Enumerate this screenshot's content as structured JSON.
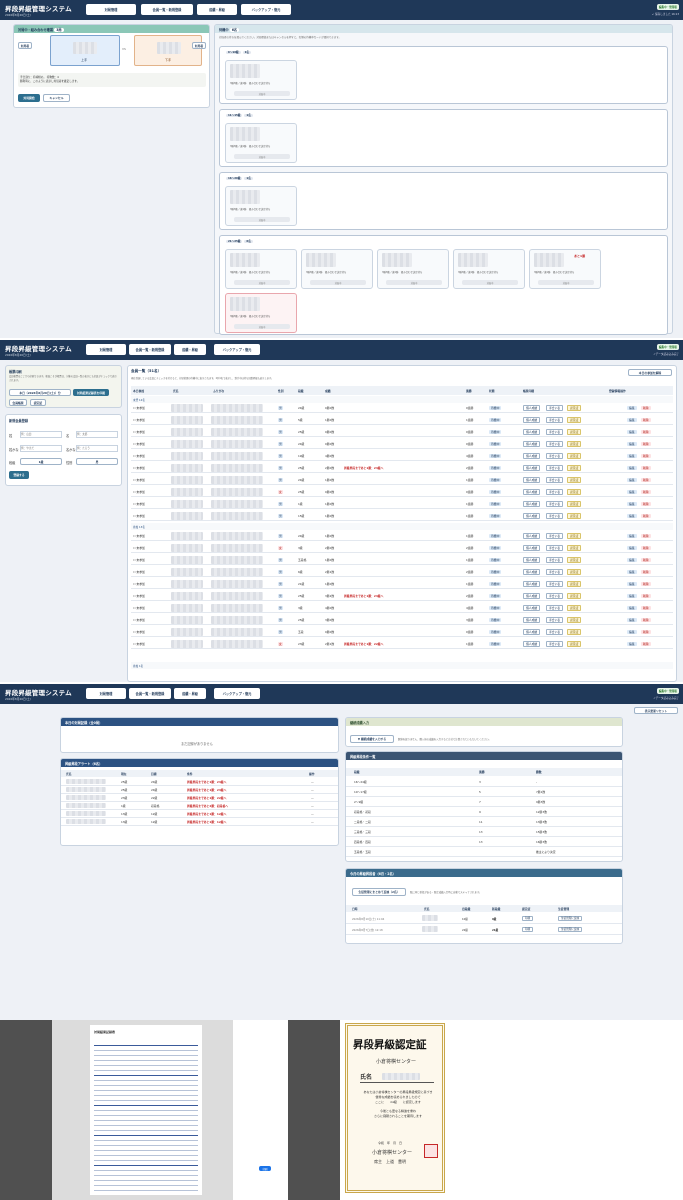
{
  "app": {
    "title": "昇段昇級管理システム",
    "date": "2026年8月26日(土)",
    "tabs": [
      "対局管理",
      "会員一覧・新規登録",
      "成績・昇級",
      "バックアップ・復元"
    ],
    "user_badge": "編集中・管理者",
    "logout": "ログアウト",
    "logout2": "↙ 保存しました 16:13",
    "logout3": "ノデータ読み込み完了"
  },
  "panel1": {
    "battle_header": "対局中・組み合わせ確認",
    "battle_badge": "3局",
    "player_a_label": "上手",
    "player_b_label": "下手",
    "vs": "VS",
    "btn_confirm": "対局確定",
    "btn_side": "対局者",
    "note1": "手合割り：",
    "note1b": "持将棋の。 持駒数：4",
    "note2": "勝利時に、このように表示し対局者を確定します。",
    "start_btn": "対局開始",
    "cancel_btn": "キャンセル",
    "wait_header": "待機中",
    "wait_badge": "6名",
    "wait_hint": "対局者の待ちを選んでください。対局開始またはキャンセルを押すと、右側の待機中カードが選択できます。",
    "groups": [
      {
        "title": "6〜10級",
        "count": "1名",
        "cards": 1
      },
      {
        "title": "11〜15級",
        "count": "1名",
        "cards": 1
      },
      {
        "title": "16〜20級",
        "count": "1名",
        "cards": 1
      },
      {
        "title": "21〜25級",
        "count": "6名",
        "cards": 6
      }
    ],
    "card_text": "3勝3敗 / 連1勝　組み合わせ決定待ち",
    "card_btn": "対局中",
    "card_alert": "あと1勝"
  },
  "panel2": {
    "list_title": "会員一覧（51名）",
    "list_hint": "現在登録している会員にチェックを付けると、対局管理の待機中に表示されます。2列1名で表示し、割引中は持ち回数昇級も表示します。",
    "today_btn": "本日の参加を解除",
    "side1_title": "帳票印刷",
    "side1_text": "会員帳票はここから印刷できます。帳面こそが帳票は、対象の会員一覧の表示にも全員がチェックで表示されます。",
    "date_select": "本日（2026年8月26日(土)）分",
    "print_btn": "対局結果記録表を印刷",
    "members_btn": "会員帳票",
    "cert_btn": "認定証",
    "side2_title": "新規会員登録",
    "f_last": "姓",
    "f_last_ph": "例：山田",
    "f_first": "名",
    "f_first_ph": "例：太郎",
    "f_lastk": "姓かな",
    "f_lastk_ph": "例：やまだ",
    "f_firstk": "名かな",
    "f_firstk_ph": "例：たろう",
    "f_rank": "段級",
    "f_rank_val": "1級",
    "f_sex": "性別",
    "f_sex_val": "男",
    "register_btn": "登録する",
    "cols": [
      "本日参加",
      "氏名",
      "ふりがな",
      "性別",
      "段級",
      "成績",
      "連勝",
      "状態",
      "帳票印刷",
      "登録情報操作"
    ],
    "group1": "未登",
    "group1_count": "12名",
    "group2": "参加",
    "group2_count": "13名",
    "group3": "参加",
    "group3_count": "1名",
    "rows1": [
      {
        "sex": "男",
        "rank": "24級",
        "rec": "0勝0敗",
        "streak": "0連勝",
        "msg": ""
      },
      {
        "sex": "男",
        "rank": "5級",
        "rec": "1勝0敗",
        "streak": "1連勝",
        "msg": ""
      },
      {
        "sex": "男",
        "rank": "25級",
        "rec": "0勝0敗",
        "streak": "0連勝",
        "msg": ""
      },
      {
        "sex": "男",
        "rank": "24級",
        "rec": "0勝0敗",
        "streak": "0連勝",
        "msg": ""
      },
      {
        "sex": "男",
        "rank": "19級",
        "rec": "4勝0敗",
        "streak": "4連勝",
        "msg": ""
      },
      {
        "sex": "男",
        "rank": "25級",
        "rec": "2勝0敗",
        "streak": "2連勝",
        "msg": "昇級昇段まであと1勝：24級へ"
      },
      {
        "sex": "男",
        "rank": "24級",
        "rec": "1勝0敗",
        "streak": "1連勝",
        "msg": ""
      },
      {
        "sex": "女",
        "rank": "25級",
        "rec": "0勝0敗",
        "streak": "0連勝",
        "msg": ""
      },
      {
        "sex": "男",
        "rank": "1級",
        "rec": "1勝0敗",
        "streak": "1連勝",
        "msg": ""
      },
      {
        "sex": "男",
        "rank": "15級",
        "rec": "1勝0敗",
        "streak": "1連勝",
        "msg": ""
      }
    ],
    "rows2": [
      {
        "sex": "男",
        "rank": "24級",
        "rec": "1勝0敗",
        "streak": "1連勝",
        "msg": ""
      },
      {
        "sex": "女",
        "rank": "3級",
        "rec": "2勝0敗",
        "streak": "2連勝",
        "msg": ""
      },
      {
        "sex": "男",
        "rank": "五段格",
        "rec": "1勝0敗",
        "streak": "1連勝",
        "msg": ""
      },
      {
        "sex": "男",
        "rank": "6級",
        "rec": "2勝1敗",
        "streak": "2連勝",
        "msg": ""
      },
      {
        "sex": "男",
        "rank": "21級",
        "rec": "1勝0敗",
        "streak": "1連勝",
        "msg": ""
      },
      {
        "sex": "男",
        "rank": "25級",
        "rec": "3勝2敗",
        "streak": "2連勝",
        "msg": "昇級昇段まであと1勝：24級へ"
      },
      {
        "sex": "男",
        "rank": "3級",
        "rec": "4勝0敗",
        "streak": "4連勝",
        "msg": ""
      },
      {
        "sex": "男",
        "rank": "25級",
        "rec": "3勝0敗",
        "streak": "3連勝",
        "msg": ""
      },
      {
        "sex": "男",
        "rank": "五段",
        "rec": "0勝0敗",
        "streak": "0連勝",
        "msg": ""
      },
      {
        "sex": "女",
        "rank": "23級",
        "rec": "2勝1敗",
        "streak": "1連勝",
        "msg": "昇級昇段まであと1勝：22級へ"
      }
    ],
    "row_status": "待機中",
    "b_personal": "個人成績",
    "b_hand": "手合い表",
    "b_cert": "認定証",
    "b_edit": "編集",
    "b_del": "削除",
    "row_join": "未参加"
  },
  "panel3": {
    "reset_btn": "表示更新リセット",
    "today_title": "本日の対局記録（全0局）",
    "today_empty": "まだ記録がありません",
    "alert_title": "昇級昇段アラート（6名）",
    "alert_cols": [
      "氏名",
      "現在",
      "目標",
      "条件",
      "操作"
    ],
    "alerts": [
      {
        "cur": "25級",
        "tgt": "24級",
        "cond": "昇級昇段まであと1勝：24級へ",
        "op": "—"
      },
      {
        "cur": "25級",
        "tgt": "24級",
        "cond": "昇級昇段まであと1勝：24級へ",
        "op": "—"
      },
      {
        "cur": "23級",
        "tgt": "22級",
        "cond": "昇級昇段まであと1勝：22級へ",
        "op": "—"
      },
      {
        "cur": "1級",
        "tgt": "初段格",
        "cond": "昇級昇段まであと2勝：初段格へ",
        "op": "—"
      },
      {
        "cur": "13級",
        "tgt": "12級",
        "cond": "昇級昇段まであと1勝：12級へ",
        "op": "—"
      },
      {
        "cur": "13級",
        "tgt": "12級",
        "cond": "昇級昇段まであと1勝：12級へ",
        "op": "—"
      }
    ],
    "input_title": "継続成績入力",
    "input_btn": "▼ 継続成績を入力する",
    "input_hint": "数値を誤りません、購入前の成績を入力すると方式で計算されていただいてください。",
    "cond_title": "昇級昇段条件一覧",
    "cond_cols": [
      "段級",
      "連勝",
      "勝数"
    ],
    "conds": [
      {
        "r": "16〜24級",
        "s": "3",
        "w": "-"
      },
      {
        "r": "10〜17級",
        "s": "5",
        "w": "7勝1敗"
      },
      {
        "r": "2〜9級",
        "s": "7",
        "w": "9勝3敗"
      },
      {
        "r": "初段格・初段",
        "s": "9",
        "w": "12勝3敗"
      },
      {
        "r": "二段格・二段",
        "s": "11",
        "w": "13勝3敗"
      },
      {
        "r": "三段格・三段",
        "s": "13",
        "w": "15勝3敗"
      },
      {
        "r": "四段格・四段",
        "s": "13",
        "w": "16勝3敗"
      },
      {
        "r": "五段格・五段",
        "s": "",
        "w": "推主により決定"
      }
    ],
    "month_title": "今月の昇級昇段者（6月・2名）",
    "month_btn": "生徒管理にまとめて反映（2名）",
    "month_hint": "既に同じ新段がある・既定成績入力時に自動でスキャナされます。",
    "month_cols": [
      "日時",
      "氏名",
      "旧段級",
      "新段級",
      "認定証",
      "生徒管理"
    ],
    "months": [
      {
        "dt": "2026年8月10日(土) 11:04",
        "old": "10級",
        "new": "9級",
        "c": "印刷",
        "m": "生徒管理に反映"
      },
      {
        "dt": "2026年8月7日(金) 12:18",
        "old": "22級",
        "new": "21級",
        "c": "印刷",
        "m": "生徒管理に反映"
      }
    ]
  },
  "panel4": {
    "sheet_title": "対局結果記録表",
    "cert_title": "昇段昇級認定証",
    "cert_org": "小倉将棋センター",
    "cert_name_label": "氏名",
    "cert_body1": "あなたは小倉将棋センターの昇段昇級規定に基づき",
    "cert_body2": "優秀な成績を収められましたので",
    "cert_body3": "ここに　　24級　　に認定します",
    "cert_body4": "今後とも更なる精進を重ね",
    "cert_body5": "さらに飛躍されることを期待します",
    "cert_date": "令和　年　月　日",
    "cert_org2": "小倉将棋センター",
    "cert_rep": "席主　上道　豊明",
    "print_lbl": "印刷"
  }
}
